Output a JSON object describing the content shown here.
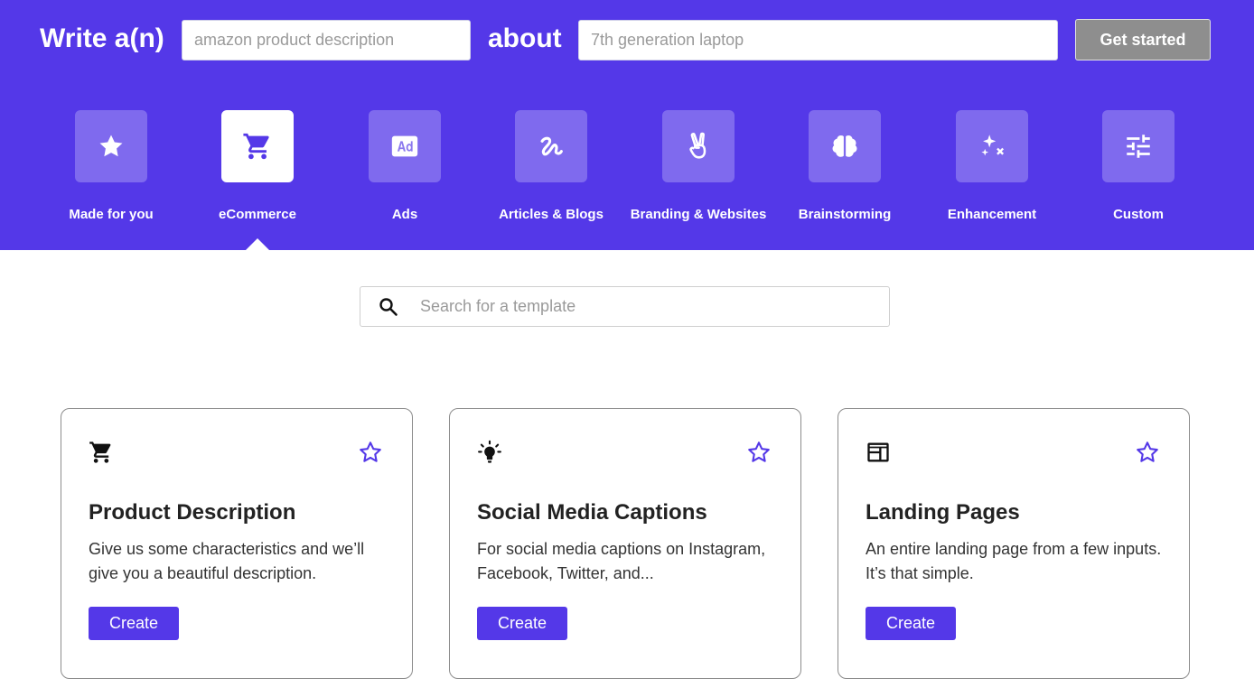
{
  "header": {
    "write_label": "Write a(n)",
    "kind_placeholder": "amazon product description",
    "about_label": "about",
    "topic_placeholder": "7th generation laptop",
    "get_started_label": "Get started"
  },
  "categories": [
    {
      "label": "Made for you",
      "icon": "star-icon"
    },
    {
      "label": "eCommerce",
      "icon": "shopping-cart-icon",
      "active": true
    },
    {
      "label": "Ads",
      "icon": "ad-icon"
    },
    {
      "label": "Articles & Blogs",
      "icon": "squiggle-icon"
    },
    {
      "label": "Branding & Websites",
      "icon": "peace-hand-icon"
    },
    {
      "label": "Brainstorming",
      "icon": "brain-icon"
    },
    {
      "label": "Enhancement",
      "icon": "sparkles-icon"
    },
    {
      "label": "Custom",
      "icon": "sliders-icon"
    }
  ],
  "search": {
    "placeholder": "Search for a template"
  },
  "cards": [
    {
      "icon": "shopping-cart-icon",
      "title": "Product Description",
      "description": "Give us some characteristics and we’ll give you a beautiful description.",
      "button": "Create"
    },
    {
      "icon": "lightbulb-icon",
      "title": "Social Media Captions",
      "description": "For social media captions on Instagram, Facebook, Twitter, and...",
      "button": "Create"
    },
    {
      "icon": "web-page-icon",
      "title": "Landing Pages",
      "description": "An entire landing page from a few inputs. It’s that simple.",
      "button": "Create"
    }
  ],
  "colors": {
    "brand": "#5438e8",
    "button_disabled": "#8e8e8e",
    "text": "#2a2a2a"
  }
}
